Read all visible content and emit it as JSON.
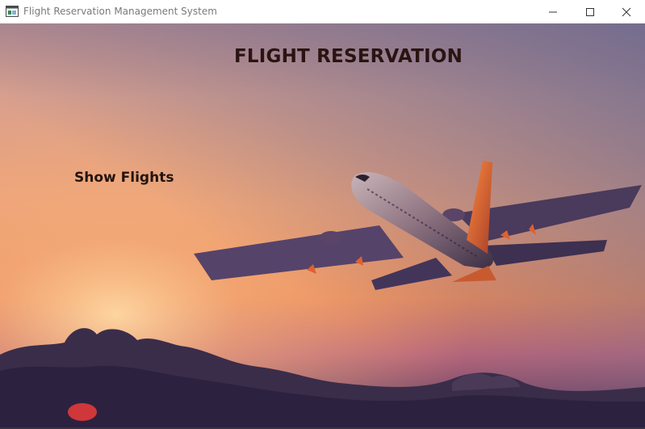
{
  "window": {
    "title": "Flight Reservation Management System",
    "controls": {
      "minimize_icon": "minimize-icon",
      "maximize_icon": "maximize-icon",
      "close_icon": "close-icon"
    }
  },
  "main": {
    "heading": "FLIGHT RESERVATION",
    "show_flights_label": "Show Flights",
    "background": "airplane-sunset-image"
  },
  "colors": {
    "heading_text": "#2a1412",
    "sky_top": "#8a7fa0",
    "sky_glow": "#f2a070",
    "clouds": "#2e2540"
  }
}
